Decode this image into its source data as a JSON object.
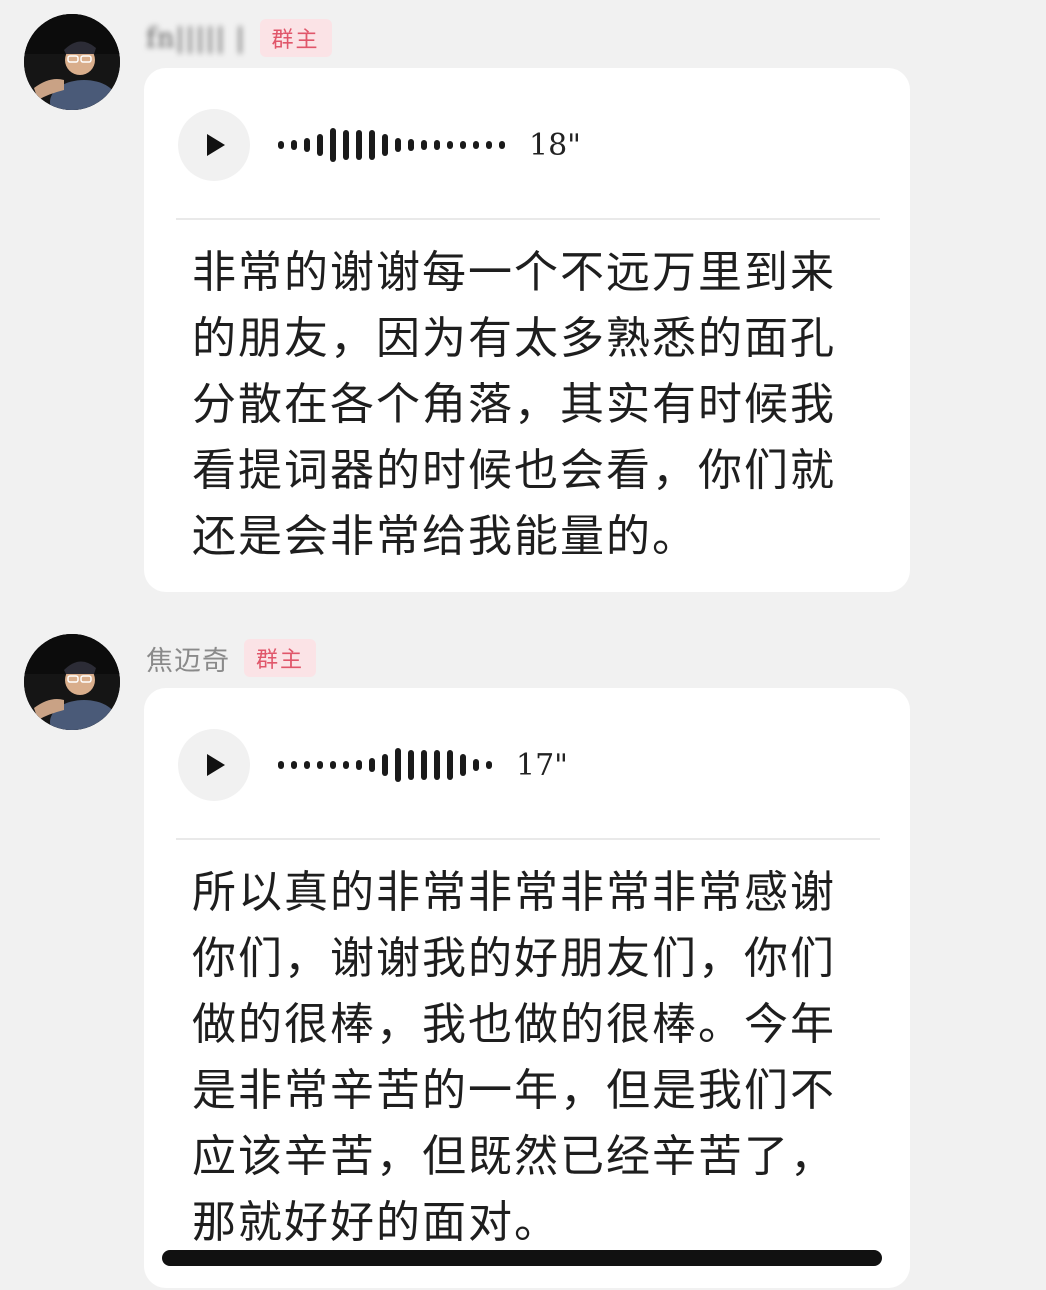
{
  "messages": [
    {
      "sender_name": "fn||||| |",
      "sender_badge": "群主",
      "voice_duration": "18\"",
      "transcript": "非常的谢谢每一个不远万里到来\n的朋友，因为有太多熟悉的面孔\n分散在各个角落，其实有时候我\n看提词器的时候也会看，你们就\n还是会非常给我能量的。"
    },
    {
      "sender_name": "焦迈奇",
      "sender_badge": "群主",
      "voice_duration": "17\"",
      "transcript": "所以真的非常非常非常非常感谢\n你们，谢谢我的好朋友们，你们\n做的很棒，我也做的很棒。今年\n是非常辛苦的一年，但是我们不\n应该辛苦，但既然已经辛苦了，\n那就好好的面对。"
    }
  ],
  "icons": {
    "play": "play-icon",
    "waveform": "voice-waveform-icon"
  },
  "colors": {
    "background": "#f1f1f1",
    "bubble": "#ffffff",
    "badge_text": "#e0566a",
    "badge_bg": "#fbe3e6"
  }
}
